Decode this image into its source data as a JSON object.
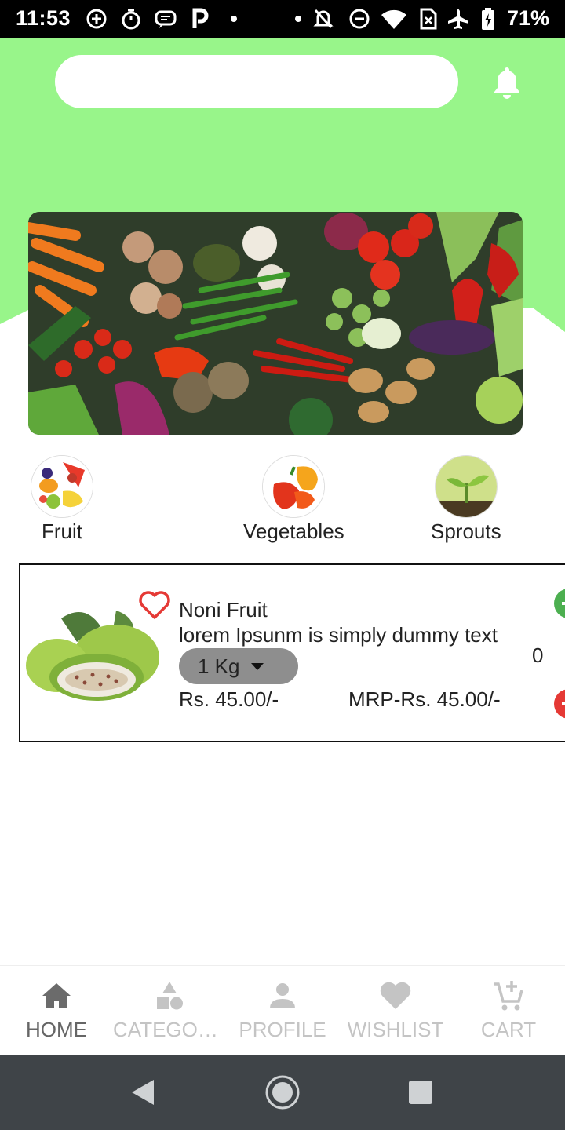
{
  "status_bar": {
    "time": "11:53",
    "battery": "71%",
    "icons": [
      "plus-circle-icon",
      "timer-icon",
      "message-icon",
      "p-icon",
      "dot-icon",
      "dot-icon",
      "bell-off-icon",
      "do-not-disturb-icon",
      "wifi-icon",
      "sim-icon",
      "airplane-icon",
      "battery-charging-icon"
    ]
  },
  "colors": {
    "header_green": "#98f58a",
    "add_green": "#4caf50",
    "remove_red": "#e53935",
    "heart_red": "#e53935",
    "nav_active": "#666666",
    "nav_inactive": "#c4c4c4",
    "system_nav": "#3f4448"
  },
  "search": {
    "value": "",
    "placeholder": ""
  },
  "categories": [
    {
      "label": "Fruit",
      "icon": "fruit-image"
    },
    {
      "label": "Vegetables",
      "icon": "vegetables-image"
    },
    {
      "label": "Sprouts",
      "icon": "sprouts-image"
    }
  ],
  "product": {
    "name": "Noni Fruit",
    "description": "lorem Ipsunm is simply dummy text",
    "quantity_option": "1 Kg",
    "price": "Rs. 45.00/-",
    "mrp": "MRP-Rs. 45.00/-",
    "count": "0"
  },
  "bottom_nav": [
    {
      "label": "HOME",
      "icon": "home-icon",
      "active": true
    },
    {
      "label": "CATEGORIES",
      "icon": "category-icon",
      "active": false
    },
    {
      "label": "PROFILE",
      "icon": "person-icon",
      "active": false
    },
    {
      "label": "WISHLIST",
      "icon": "heart-icon",
      "active": false
    },
    {
      "label": "CART",
      "icon": "cart-add-icon",
      "active": false
    }
  ]
}
